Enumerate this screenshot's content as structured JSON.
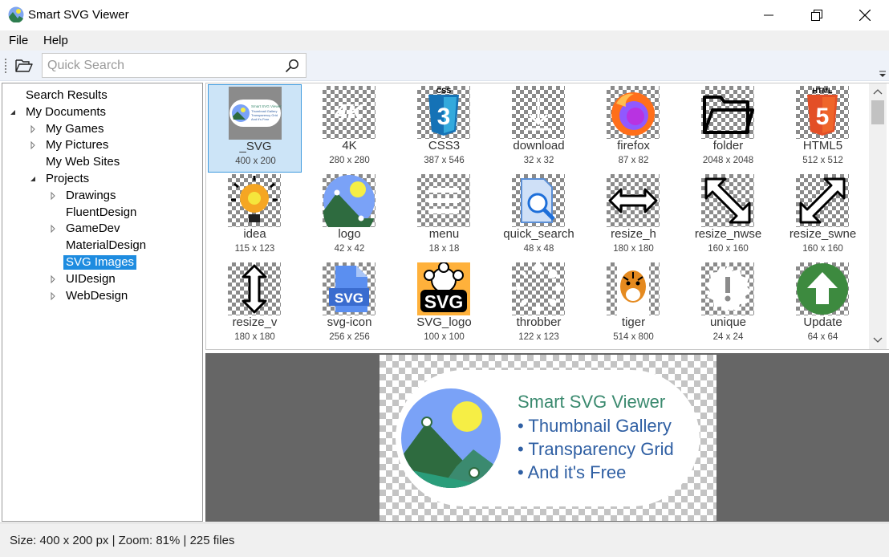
{
  "window": {
    "title": "Smart SVG Viewer"
  },
  "menu": {
    "items": [
      "File",
      "Help"
    ]
  },
  "toolbar": {
    "search_placeholder": "Quick Search"
  },
  "tree": {
    "items": [
      {
        "label": "Search Results",
        "level": 0,
        "expander": "none"
      },
      {
        "label": "My Documents",
        "level": 0,
        "expander": "expanded"
      },
      {
        "label": "My Games",
        "level": 1,
        "expander": "collapsed"
      },
      {
        "label": "My Pictures",
        "level": 1,
        "expander": "collapsed"
      },
      {
        "label": "My Web Sites",
        "level": 1,
        "expander": "none"
      },
      {
        "label": "Projects",
        "level": 1,
        "expander": "expanded"
      },
      {
        "label": "Drawings",
        "level": 2,
        "expander": "collapsed"
      },
      {
        "label": "FluentDesign",
        "level": 2,
        "expander": "none"
      },
      {
        "label": "GameDev",
        "level": 2,
        "expander": "collapsed"
      },
      {
        "label": "MaterialDesign",
        "level": 2,
        "expander": "none"
      },
      {
        "label": "SVG Images",
        "level": 2,
        "expander": "none",
        "selected": true
      },
      {
        "label": "UIDesign",
        "level": 2,
        "expander": "collapsed"
      },
      {
        "label": "WebDesign",
        "level": 2,
        "expander": "collapsed"
      }
    ]
  },
  "gallery": {
    "items": [
      {
        "name": "_SVG",
        "size": "400 x 200",
        "icon": "svg-banner-icon",
        "selected": true
      },
      {
        "name": "4K",
        "size": "280 x 280",
        "icon": "4k-icon"
      },
      {
        "name": "CSS3",
        "size": "387 x 546",
        "icon": "css3-icon"
      },
      {
        "name": "download",
        "size": "32 x 32",
        "icon": "download-icon"
      },
      {
        "name": "firefox",
        "size": "87 x 82",
        "icon": "firefox-icon"
      },
      {
        "name": "folder",
        "size": "2048 x 2048",
        "icon": "folder-icon"
      },
      {
        "name": "HTML5",
        "size": "512 x 512",
        "icon": "html5-icon"
      },
      {
        "name": "idea",
        "size": "115 x 123",
        "icon": "idea-icon"
      },
      {
        "name": "logo",
        "size": "42 x 42",
        "icon": "logo-icon"
      },
      {
        "name": "menu",
        "size": "18 x 18",
        "icon": "menu-icon"
      },
      {
        "name": "quick_search",
        "size": "48 x 48",
        "icon": "quick-search-icon"
      },
      {
        "name": "resize_h",
        "size": "180 x 180",
        "icon": "resize-h-icon"
      },
      {
        "name": "resize_nwse",
        "size": "160 x 160",
        "icon": "resize-nwse-icon"
      },
      {
        "name": "resize_swne",
        "size": "160 x 160",
        "icon": "resize-swne-icon"
      },
      {
        "name": "resize_v",
        "size": "180 x 180",
        "icon": "resize-v-icon"
      },
      {
        "name": "svg-icon",
        "size": "256 x 256",
        "icon": "svg-file-icon"
      },
      {
        "name": "SVG_logo",
        "size": "100 x 100",
        "icon": "svg-logo-icon"
      },
      {
        "name": "throbber",
        "size": "122 x 123",
        "icon": "throbber-icon"
      },
      {
        "name": "tiger",
        "size": "514 x 800",
        "icon": "tiger-icon"
      },
      {
        "name": "unique",
        "size": "24 x 24",
        "icon": "unique-icon"
      },
      {
        "name": "Update",
        "size": "64 x 64",
        "icon": "update-icon"
      }
    ],
    "thumb_text": {
      "svg_banner": [
        "Smart SVG Viewer",
        "Thumbnail Gallery",
        "Transparency Grid",
        "And it's Free"
      ],
      "four_k": "4K",
      "css": "CSS",
      "html": "HTML",
      "svg_badge": "SVG"
    }
  },
  "preview": {
    "title": "Smart SVG Viewer",
    "bullets": [
      "• Thumbnail Gallery",
      "• Transparency Grid",
      "• And it's Free"
    ]
  },
  "status": {
    "text": "Size: 400 x 200 px | Zoom: 81% | 225 files"
  },
  "colors": {
    "accent": "#1e8ce0",
    "selection_bg": "#cce4f7",
    "promo_title": "#3b8a6f",
    "promo_text": "#2f5fa3"
  }
}
